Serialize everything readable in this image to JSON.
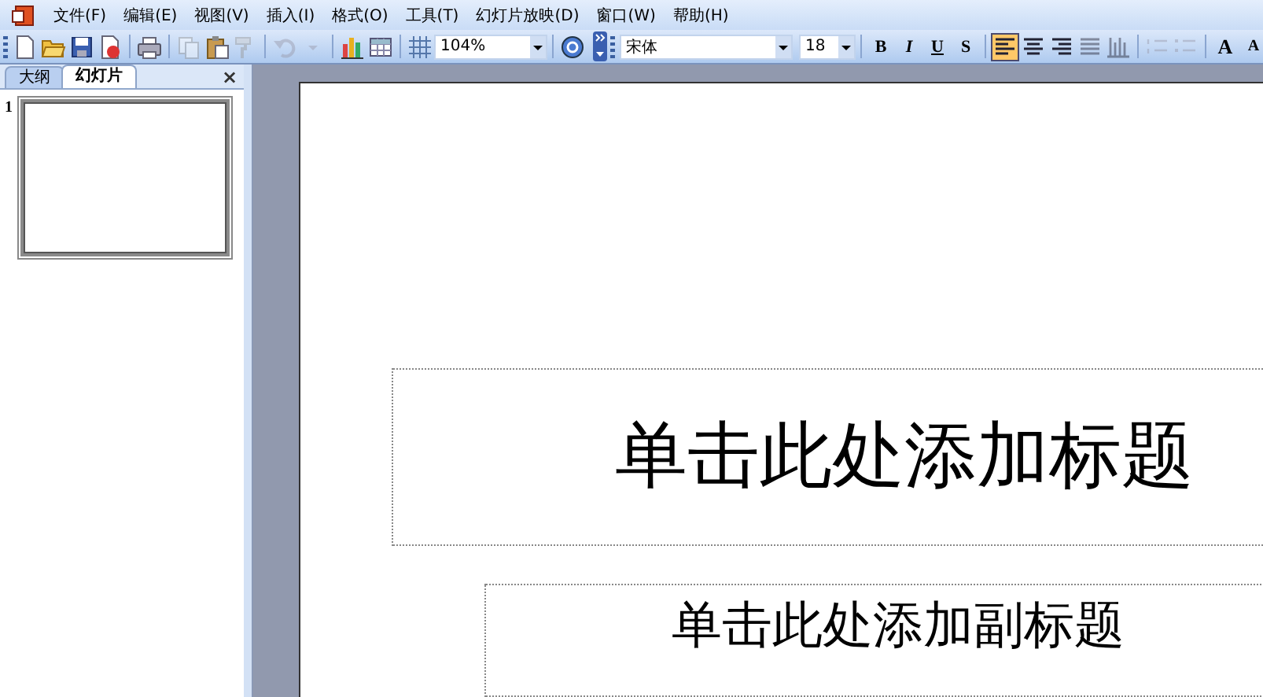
{
  "menu_bar": {
    "items": [
      "文件(F)",
      "编辑(E)",
      "视图(V)",
      "插入(I)",
      "格式(O)",
      "工具(T)",
      "幻灯片放映(D)",
      "窗口(W)",
      "帮助(H)"
    ]
  },
  "standard_toolbar": {
    "tools": [
      {
        "kind": "new",
        "disabled": false
      },
      {
        "kind": "open",
        "disabled": false
      },
      {
        "kind": "save",
        "disabled": false
      },
      {
        "kind": "permission",
        "disabled": false
      },
      {
        "kind": "sep"
      },
      {
        "kind": "print",
        "disabled": false
      },
      {
        "kind": "sep"
      },
      {
        "kind": "copy",
        "disabled": true
      },
      {
        "kind": "paste",
        "disabled": false
      },
      {
        "kind": "painter",
        "disabled": true
      },
      {
        "kind": "sep"
      },
      {
        "kind": "undo",
        "disabled": true
      },
      {
        "kind": "caret",
        "disabled": true
      },
      {
        "kind": "sep"
      },
      {
        "kind": "chart",
        "disabled": false
      },
      {
        "kind": "table",
        "disabled": false
      },
      {
        "kind": "sep"
      },
      {
        "kind": "grid",
        "disabled": false
      },
      {
        "kind": "zoom",
        "value": "104%"
      },
      {
        "kind": "sep"
      },
      {
        "kind": "help",
        "disabled": false
      }
    ]
  },
  "formatting_toolbar": {
    "font": "宋体",
    "size": "18",
    "style_buttons": [
      {
        "label": "B",
        "selected": false
      },
      {
        "label": "I",
        "selected": false
      },
      {
        "label": "U",
        "selected": false
      },
      {
        "label": "S",
        "selected": false
      }
    ],
    "align_buttons": [
      {
        "kind": "left",
        "selected": true,
        "disabled": false
      },
      {
        "kind": "center",
        "selected": false,
        "disabled": false
      },
      {
        "kind": "right",
        "selected": false,
        "disabled": false
      },
      {
        "kind": "justify",
        "selected": false,
        "disabled": true
      },
      {
        "kind": "distribute",
        "selected": false,
        "disabled": true
      }
    ],
    "list_buttons": [
      {
        "kind": "numbered",
        "disabled": true
      },
      {
        "kind": "bulleted",
        "disabled": true
      }
    ],
    "size_buttons": [
      {
        "label": "A",
        "kind": "grow"
      },
      {
        "label": "A",
        "kind": "shrink"
      }
    ]
  },
  "side_panel": {
    "tabs": [
      {
        "label": "大纲",
        "selected": false
      },
      {
        "label": "幻灯片",
        "selected": true
      }
    ],
    "close": "×",
    "slides": [
      {
        "number": "1",
        "selected": true
      }
    ]
  },
  "slide": {
    "title_placeholder": "单击此处添加标题",
    "subtitle_placeholder": "单击此处添加副标题"
  }
}
